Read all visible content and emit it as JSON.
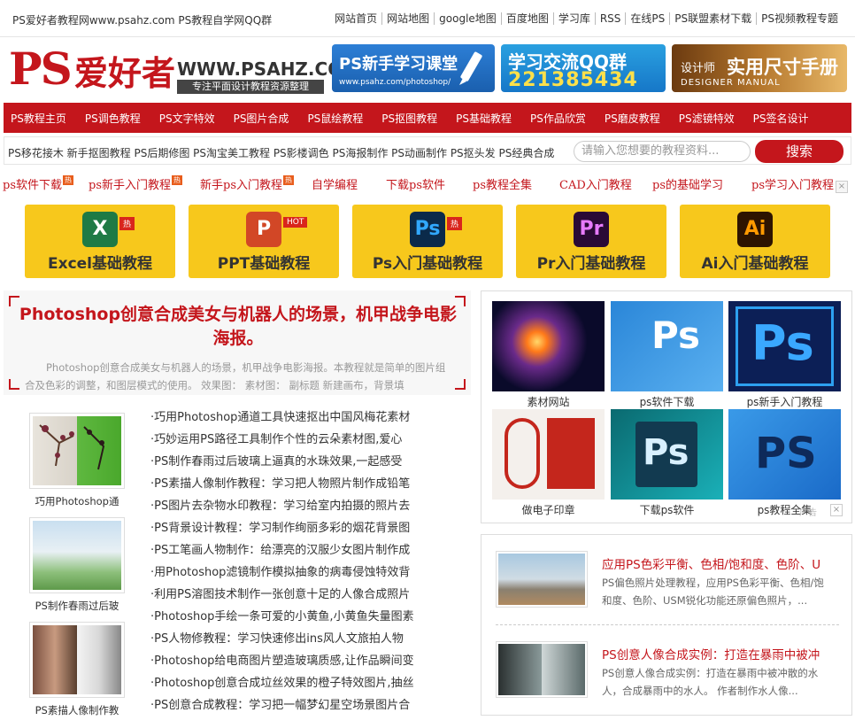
{
  "topbar": {
    "site": "PS爱好者教程网www.psahz.com PS教程自学网QQ群",
    "links": [
      "网站首页",
      "网站地图",
      "google地图",
      "百度地图",
      "学习库",
      "RSS",
      "在线PS",
      "PS联盟素材下载",
      "PS视频教程专题"
    ]
  },
  "header": {
    "logo_ps": "PS",
    "logo_cn": "爱好者",
    "logo_url": "WWW.PSAHZ.COM",
    "logo_sub": "专注平面设计教程资源整理",
    "banner1_title": "PS新手学习课堂",
    "banner1_url": "www.psahz.com/photoshop/",
    "banner2_title": "学习交流QQ群",
    "banner2_number": "221385434",
    "banner3_small": "设计师",
    "banner3_big": "实用尺寸手册",
    "banner3_en": "DESIGNER MANUAL"
  },
  "nav": [
    "PS教程主页",
    "PS调色教程",
    "PS文字特效",
    "PS图片合成",
    "PS鼠绘教程",
    "PS抠图教程",
    "PS基础教程",
    "PS作品欣赏",
    "PS磨皮教程",
    "PS滤镜特效",
    "PS签名设计"
  ],
  "subnav": {
    "tags": "PS移花接木 新手抠图教程 PS后期修图 PS淘宝美工教程 PS影楼调色 PS海报制作 PS动画制作 PS抠头发 PS经典合成",
    "search_placeholder": "请输入您想要的教程资料...",
    "search_button": "搜索"
  },
  "hotlinks": [
    {
      "label": "ps软件下载",
      "badge": "热"
    },
    {
      "label": "ps新手入门教程",
      "badge": "热"
    },
    {
      "label": "新手ps入门教程",
      "badge": "热"
    },
    {
      "label": "自学编程",
      "badge": ""
    },
    {
      "label": "下载ps软件",
      "badge": ""
    },
    {
      "label": "ps教程全集",
      "badge": ""
    },
    {
      "label": "CAD入门教程",
      "badge": ""
    },
    {
      "label": "ps的基础学习",
      "badge": ""
    },
    {
      "label": "ps学习入门教程",
      "badge": ""
    }
  ],
  "close_x": "×",
  "tiles": [
    {
      "label": "Excel基础教程",
      "icon": "X",
      "badge": "热",
      "color": "#1f7a45"
    },
    {
      "label": "PPT基础教程",
      "icon": "P",
      "badge": "HOT",
      "color": "#d24726"
    },
    {
      "label": "Ps入门基础教程",
      "icon": "Ps",
      "badge": "热",
      "color": "#0b2a4a"
    },
    {
      "label": "Pr入门基础教程",
      "icon": "Pr",
      "badge": "",
      "color": "#2a0a36"
    },
    {
      "label": "Ai入门基础教程",
      "icon": "Ai",
      "badge": "",
      "color": "#2e1400"
    }
  ],
  "headline": {
    "title": "Photoshop创意合成美女与机器人的场景，机甲战争电影海报。",
    "desc": "Photoshop创意合成美女与机器人的场景，机甲战争电影海报。本教程就是简单的图片组合及色彩的调整，和图层模式的使用。 效果图： 素材图： 副标题 新建画布，背景填"
  },
  "thumbs": [
    {
      "caption": "巧用Photoshop通"
    },
    {
      "caption": "PS制作春雨过后玻"
    },
    {
      "caption": "PS素描人像制作教"
    }
  ],
  "articles": [
    "·巧用Photoshop通道工具快速抠出中国风梅花素材",
    "·巧妙运用PS路径工具制作个性的云朵素材图,爱心",
    "·PS制作春雨过后玻璃上逼真的水珠效果,一起感受",
    "·PS素描人像制作教程：学习把人物照片制作成铅笔",
    "·PS图片去杂物水印教程：学习给室内拍摄的照片去",
    "·PS背景设计教程：学习制作绚丽多彩的烟花背景图",
    "·PS工笔画人物制作：给漂亮的汉服少女图片制作成",
    "·用Photoshop滤镜制作模拟抽象的病毒侵蚀特效背",
    "·利用PS溶图技术制作一张创意十足的人像合成照片",
    "·Photoshop手绘一条可爱的小黄鱼,小黄鱼失量图素",
    "·PS人物修教程：学习快速修出ins风人文旅拍人物",
    "·Photoshop给电商图片塑造玻璃质感,让作品瞬间变",
    "·Photoshop创意合成垃丝效果的橙子特效图片,抽丝",
    "·PS创意合成教程：学习把一幅梦幻星空场景图片合"
  ],
  "rgrid": [
    {
      "caption": "素材网站"
    },
    {
      "caption": "ps软件下载",
      "icon": "Ps"
    },
    {
      "caption": "ps新手入门教程",
      "icon": "Ps"
    },
    {
      "caption": "做电子印章"
    },
    {
      "caption": "下载ps软件",
      "icon": "Ps"
    },
    {
      "caption": "ps教程全集",
      "icon": "PS"
    }
  ],
  "ad_tag": "广告",
  "ad_x": "×",
  "rarticles": [
    {
      "title": "应用PS色彩平衡、色相/饱和度、色阶、U",
      "desc": "PS偏色照片处理教程，应用PS色彩平衡、色相/饱和度、色阶、USM锐化功能还原偏色照片，..."
    },
    {
      "title": "PS创意人像合成实例：打造在暴雨中被冲",
      "desc": "PS创意人像合成实例：打造在暴雨中被冲散的水人，合成暴雨中的水人。 作者制作水人像..."
    }
  ]
}
